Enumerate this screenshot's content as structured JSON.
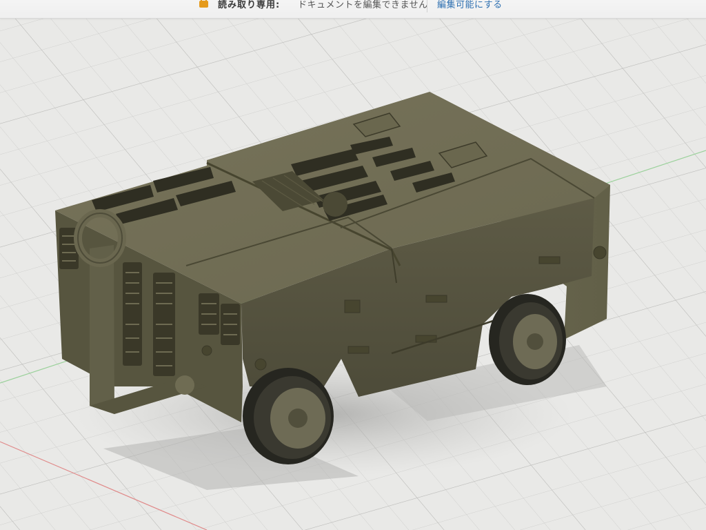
{
  "banner": {
    "readonly_label": "読み取り専用:",
    "readonly_message": "ドキュメントを編集できません",
    "enable_editing": "編集可能にする"
  },
  "icons": {
    "banner_lock": "lock-icon"
  },
  "colors": {
    "lock": "#e59a1c",
    "link": "#2d6fb0",
    "grid_bg": "#e9e9e7",
    "model": "#625f47"
  }
}
